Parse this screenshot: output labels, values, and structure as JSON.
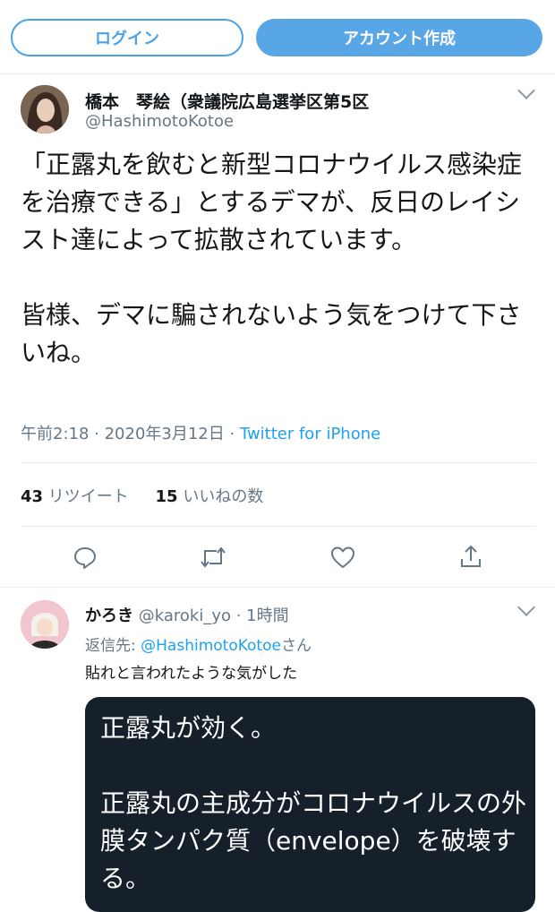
{
  "header": {
    "login_label": "ログイン",
    "signup_label": "アカウント作成"
  },
  "tweet": {
    "display_name": "橋本　琴絵（衆議院広島選挙区第5区",
    "handle": "@HashimotoKotoe",
    "text": "「正露丸を飲むと新型コロナウイルス感染症を治療できる」とするデマが、反日のレイシスト達によって拡散されています。\n\n皆様、デマに騙されないよう気をつけて下さいね。",
    "time": "午前2:18 · 2020年3月12日 · ",
    "source": "Twitter for iPhone",
    "retweet_count": "43",
    "retweet_label": "リツイート",
    "like_count": "15",
    "like_label": "いいねの数"
  },
  "actions": [
    "reply-icon",
    "retweet-icon",
    "like-icon",
    "share-icon"
  ],
  "reply": {
    "display_name": "かろき",
    "handle_time": "@karoki_yo · 1時間",
    "replying_prefix": "返信先: ",
    "replying_user": "@HashimotoKotoe",
    "replying_suffix": "さん",
    "text": "貼れと言われたような気がした",
    "image_text": "正露丸が効く。\n\n正露丸の主成分がコロナウイルスの外膜タンパク質（envelope）を破壊する。"
  },
  "colors": {
    "accent": "#1da1f2",
    "button_fill": "#58a6e6",
    "muted": "#657786",
    "card_bg": "#15202b"
  }
}
